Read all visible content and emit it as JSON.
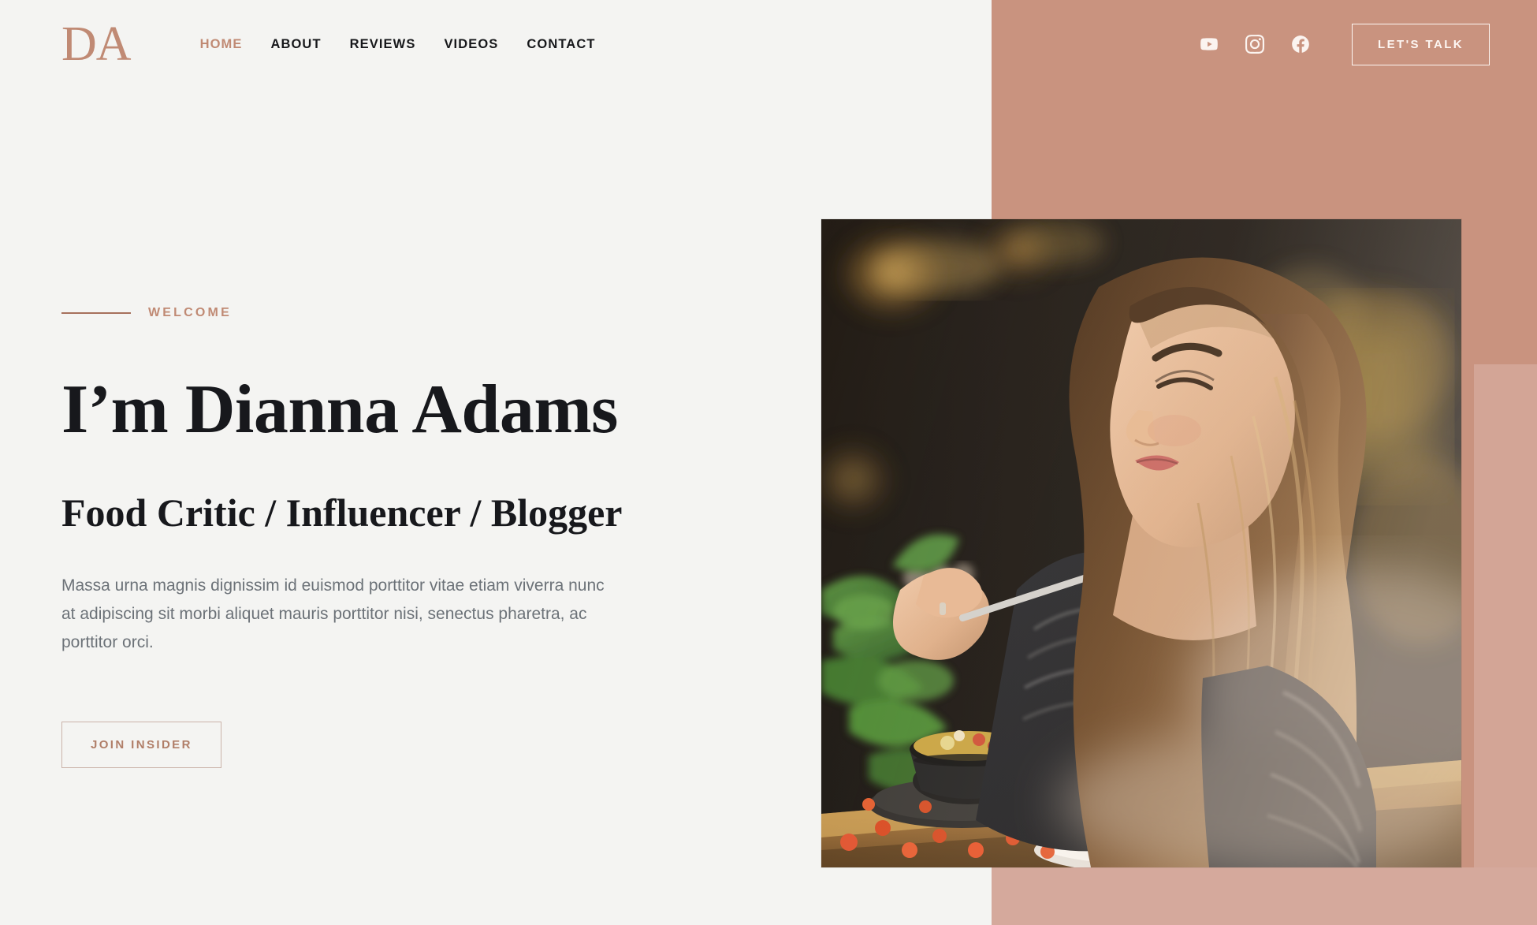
{
  "brand": {
    "logo": "DA",
    "logo_color": "#c08a74"
  },
  "nav": {
    "items": [
      {
        "label": "HOME",
        "active": true
      },
      {
        "label": "ABOUT",
        "active": false
      },
      {
        "label": "REVIEWS",
        "active": false
      },
      {
        "label": "VIDEOS",
        "active": false
      },
      {
        "label": "CONTACT",
        "active": false
      }
    ]
  },
  "header": {
    "socials": [
      {
        "name": "youtube",
        "label": "YouTube"
      },
      {
        "name": "instagram",
        "label": "Instagram"
      },
      {
        "name": "facebook",
        "label": "Facebook"
      }
    ],
    "cta_label": "LET'S TALK"
  },
  "hero": {
    "eyebrow": "WELCOME",
    "title": "I’m Dianna Adams",
    "subtitle": "Food Critic / Influencer / Blogger",
    "paragraph": "Massa urna magnis dignissim id euismod porttitor vitae etiam viverra nunc at adipiscing sit morbi aliquet mauris porttitor nisi, senectus pharetra, ac porttitor orci.",
    "button_label": "JOIN INSIDER",
    "image_alt": "Woman eating food at a cafe table with a yellow coffee cup"
  },
  "colors": {
    "page_background": "#f4f4f2",
    "accent": "#c08a74",
    "block_terracotta": "#c9937f",
    "block_terracotta_light": "#d3a596",
    "heading": "#17181c",
    "body_text": "#6c7278",
    "button_outline_light": "#fdf6f2"
  }
}
